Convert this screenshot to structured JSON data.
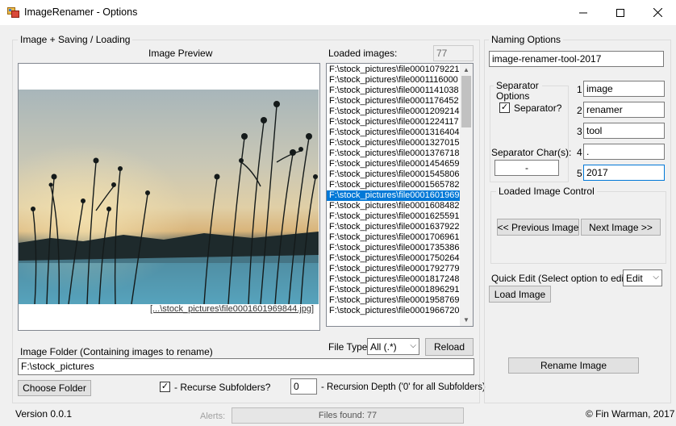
{
  "window": {
    "title": "ImageRenamer - Options",
    "minimize": "—",
    "maximize": "☐",
    "close": "✕"
  },
  "left_group": {
    "title": "Image + Saving / Loading",
    "preview_label": "Image Preview",
    "preview_filename": "[...\\stock_pictures\\file0001601969844.jpg]",
    "loaded_images_label": "Loaded images:",
    "loaded_count": "77",
    "files": [
      "F:\\stock_pictures\\file0001079221",
      "F:\\stock_pictures\\file0001116000",
      "F:\\stock_pictures\\file0001141038",
      "F:\\stock_pictures\\file0001176452",
      "F:\\stock_pictures\\file0001209214",
      "F:\\stock_pictures\\file0001224117",
      "F:\\stock_pictures\\file0001316404",
      "F:\\stock_pictures\\file0001327015",
      "F:\\stock_pictures\\file0001376718",
      "F:\\stock_pictures\\file0001454659",
      "F:\\stock_pictures\\file0001545806",
      "F:\\stock_pictures\\file0001565782",
      "F:\\stock_pictures\\file0001601969",
      "F:\\stock_pictures\\file0001608482",
      "F:\\stock_pictures\\file0001625591",
      "F:\\stock_pictures\\file0001637922",
      "F:\\stock_pictures\\file0001706961",
      "F:\\stock_pictures\\file0001735386",
      "F:\\stock_pictures\\file0001750264",
      "F:\\stock_pictures\\file0001792779",
      "F:\\stock_pictures\\file0001817248",
      "F:\\stock_pictures\\file0001896291",
      "F:\\stock_pictures\\file0001958769",
      "F:\\stock_pictures\\file0001966720"
    ],
    "file_type_label": "File Type:",
    "file_type_value": "All (.*)",
    "reload_label": "Reload",
    "folder_label": "Image Folder (Containing images to rename)",
    "folder_value": "F:\\stock_pictures",
    "choose_folder_label": "Choose Folder",
    "recurse_label": "- Recurse Subfolders?",
    "recurse_checked": "✓",
    "recursion_depth_value": "0",
    "recursion_depth_label": "- Recursion Depth ('0' for all Subfolders)"
  },
  "naming": {
    "title": "Naming Options",
    "preview_name": "image-renamer-tool-2017",
    "separator_group_title": "Separator Options",
    "separator_checkbox_label": "Separator?",
    "separator_checked": "✓",
    "separator_char_label": "Separator Char(s):",
    "separator_char_value": "-",
    "parts": [
      {
        "num": "1",
        "value": "image"
      },
      {
        "num": "2",
        "value": "renamer"
      },
      {
        "num": "3",
        "value": "tool"
      },
      {
        "num": "4",
        "value": "."
      },
      {
        "num": "5",
        "value": "2017"
      }
    ],
    "loaded_control_title": "Loaded Image Control",
    "prev_label": "<< Previous Image",
    "next_label": "Next Image >>",
    "quick_edit_label": "Quick Edit (Select option to edit):",
    "quick_edit_value": "Edit",
    "load_image_label": "Load Image",
    "rename_label": "Rename Image"
  },
  "footer": {
    "version": "Version 0.0.1",
    "alerts_label": "Alerts:",
    "status": "Files found: 77",
    "copyright": "© Fin Warman, 2017"
  },
  "colors": {
    "selection": "#0078d7",
    "window_bg": "#f0f0f0"
  }
}
